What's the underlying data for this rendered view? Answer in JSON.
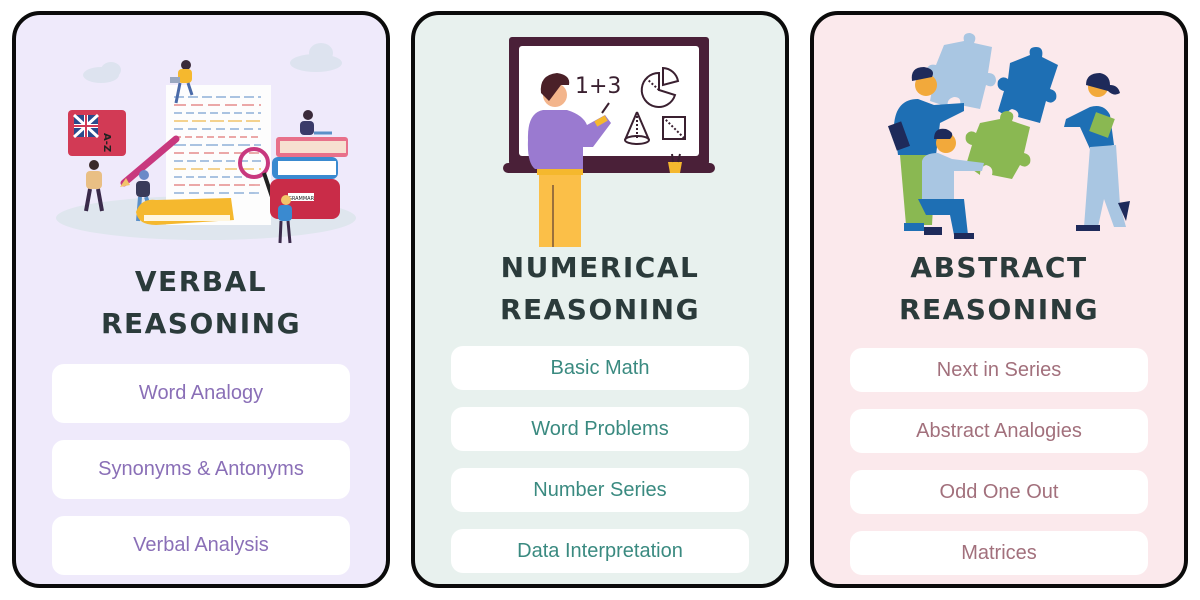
{
  "cards": [
    {
      "id": "verbal",
      "title_line1": "VERBAL",
      "title_line2": "REASONING",
      "illustration": "verbal-reasoning-illustration",
      "illustration_labels": {
        "dictionary_spine": "A-Z",
        "book_label": "GRAMMAR"
      },
      "accent": "#8a6fb7",
      "background": "#efeafb",
      "items": [
        {
          "label": "Word Analogy"
        },
        {
          "label": "Synonyms & Antonyms"
        },
        {
          "label": "Verbal Analysis"
        }
      ]
    },
    {
      "id": "numerical",
      "title_line1": "NUMERICAL",
      "title_line2": "REASONING",
      "illustration": "numerical-reasoning-illustration",
      "illustration_labels": {
        "board_equation": "1+3"
      },
      "accent": "#3a8a80",
      "background": "#e8f1ee",
      "items": [
        {
          "label": "Basic Math"
        },
        {
          "label": "Word Problems"
        },
        {
          "label": "Number Series"
        },
        {
          "label": "Data Interpretation"
        }
      ]
    },
    {
      "id": "abstract",
      "title_line1": "ABSTRACT",
      "title_line2": "REASONING",
      "illustration": "abstract-reasoning-illustration",
      "accent": "#a2707c",
      "background": "#fbe9ec",
      "items": [
        {
          "label": "Next in Series"
        },
        {
          "label": "Abstract Analogies"
        },
        {
          "label": "Odd One Out"
        },
        {
          "label": "Matrices"
        }
      ]
    }
  ]
}
